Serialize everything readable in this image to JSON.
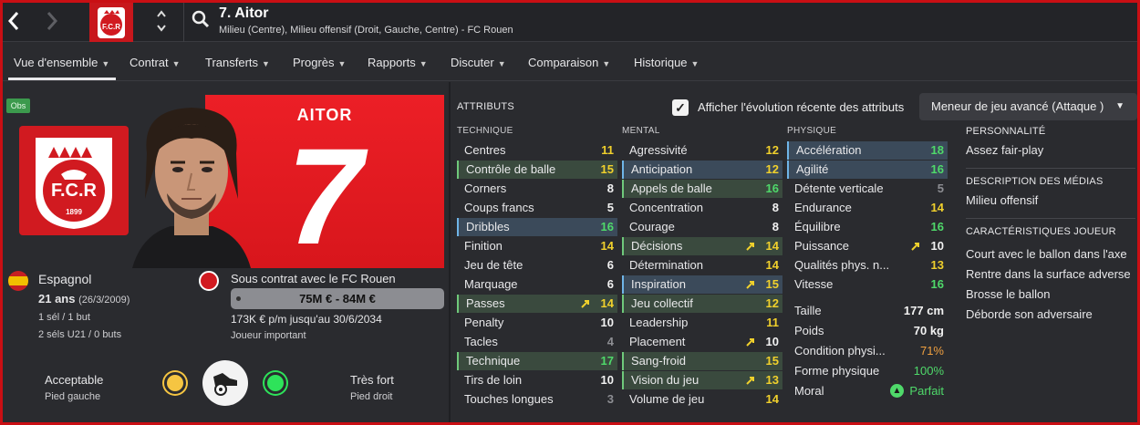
{
  "header": {
    "player_title": "7. Aitor",
    "player_subtitle": "Milieu (Centre), Milieu offensif (Droit, Gauche, Centre) - FC Rouen",
    "back_icon": "chevron-left-icon",
    "forward_icon": "chevron-right-icon"
  },
  "tabs": [
    {
      "label": "Vue d'ensemble"
    },
    {
      "label": "Contrat"
    },
    {
      "label": "Transferts"
    },
    {
      "label": "Progrès"
    },
    {
      "label": "Rapports"
    },
    {
      "label": "Discuter"
    },
    {
      "label": "Comparaison"
    },
    {
      "label": "Historique"
    }
  ],
  "overview": {
    "obs_badge": "Obs",
    "club_badge_text": "F.C.R",
    "club_badge_year": "1899",
    "banner_name": "AITOR",
    "banner_number": "7",
    "nationality": "Espagnol",
    "age": "21 ans",
    "dob": "(26/3/2009)",
    "caps": "1 sél / 1 but",
    "u21_caps": "2 séls U21 / 0 buts",
    "contract_text": "Sous contrat avec le FC Rouen",
    "value_range": "75M € - 84M €",
    "wage_text": "173K € p/m jusqu'au 30/6/2034",
    "squad_status": "Joueur important",
    "left_foot_rating": "Acceptable",
    "left_foot_label": "Pied gauche",
    "right_foot_rating": "Très fort",
    "right_foot_label": "Pied droit",
    "left_foot_color": "#f5c542",
    "right_foot_color": "#2ee35a"
  },
  "attributes": {
    "header": "ATTRIBUTS",
    "show_evolution_label": "Afficher l'évolution récente des attributs",
    "show_evolution_checked": true,
    "role_selector": "Meneur de jeu avancé (Attaque )",
    "technique_header": "TECHNIQUE",
    "mental_header": "MENTAL",
    "physique_header": "PHYSIQUE",
    "technique": [
      {
        "name": "Centres",
        "value": "11"
      },
      {
        "name": "Contrôle de balle",
        "value": "15"
      },
      {
        "name": "Corners",
        "value": "8"
      },
      {
        "name": "Coups francs",
        "value": "5"
      },
      {
        "name": "Dribbles",
        "value": "16"
      },
      {
        "name": "Finition",
        "value": "14"
      },
      {
        "name": "Jeu de tête",
        "value": "6"
      },
      {
        "name": "Marquage",
        "value": "6"
      },
      {
        "name": "Passes",
        "value": "14"
      },
      {
        "name": "Penalty",
        "value": "10"
      },
      {
        "name": "Tacles",
        "value": "4"
      },
      {
        "name": "Technique",
        "value": "17"
      },
      {
        "name": "Tirs de loin",
        "value": "10"
      },
      {
        "name": "Touches longues",
        "value": "3"
      }
    ],
    "mental": [
      {
        "name": "Agressivité",
        "value": "12"
      },
      {
        "name": "Anticipation",
        "value": "12"
      },
      {
        "name": "Appels de balle",
        "value": "16"
      },
      {
        "name": "Concentration",
        "value": "8"
      },
      {
        "name": "Courage",
        "value": "8"
      },
      {
        "name": "Décisions",
        "value": "14"
      },
      {
        "name": "Détermination",
        "value": "14"
      },
      {
        "name": "Inspiration",
        "value": "15"
      },
      {
        "name": "Jeu collectif",
        "value": "12"
      },
      {
        "name": "Leadership",
        "value": "11"
      },
      {
        "name": "Placement",
        "value": "10"
      },
      {
        "name": "Sang-froid",
        "value": "15"
      },
      {
        "name": "Vision du jeu",
        "value": "13"
      },
      {
        "name": "Volume de jeu",
        "value": "14"
      }
    ],
    "physique": [
      {
        "name": "Accélération",
        "value": "18"
      },
      {
        "name": "Agilité",
        "value": "16"
      },
      {
        "name": "Détente verticale",
        "value": "5"
      },
      {
        "name": "Endurance",
        "value": "14"
      },
      {
        "name": "Équilibre",
        "value": "16"
      },
      {
        "name": "Puissance",
        "value": "10"
      },
      {
        "name": "Qualités phys. n...",
        "value": "13"
      },
      {
        "name": "Vitesse",
        "value": "16"
      }
    ],
    "body": [
      {
        "name": "Taille",
        "value": "177 cm"
      },
      {
        "name": "Poids",
        "value": "70 kg"
      },
      {
        "name": "Condition physi...",
        "value": "71%"
      },
      {
        "name": "Forme physique",
        "value": "100%"
      },
      {
        "name": "Moral",
        "value": "Parfait"
      }
    ]
  },
  "side": {
    "personality_header": "PERSONNALITÉ",
    "personality": "Assez fair-play",
    "media_header": "DESCRIPTION DES MÉDIAS",
    "media": "Milieu offensif",
    "traits_header": "CARACTÉRISTIQUES JOUEUR",
    "traits": [
      "Court avec le ballon dans l'axe",
      "Rentre dans la surface adverse",
      "Brosse le ballon",
      "Déborde son adversaire"
    ]
  }
}
